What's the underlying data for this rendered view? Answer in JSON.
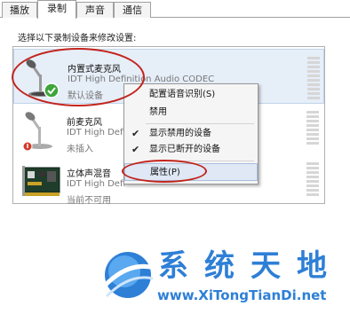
{
  "tabs": [
    {
      "label": "播放"
    },
    {
      "label": "录制"
    },
    {
      "label": "声音"
    },
    {
      "label": "通信"
    }
  ],
  "instruction": "选择以下录制设备来修改设置:",
  "devices": [
    {
      "name": "内置式麦克风",
      "description": "IDT High Definition Audio CODEC",
      "status": "默认设备",
      "icon": "microphone-default-icon"
    },
    {
      "name": "前麦克风",
      "description": "IDT High Defi",
      "status": "未插入",
      "icon": "microphone-unplugged-icon"
    },
    {
      "name": "立体声混音",
      "description": "IDT High Defi",
      "status": "当前不可用",
      "icon": "sound-card-icon"
    }
  ],
  "context_menu": {
    "items": [
      {
        "label": "配置语音识别(S)",
        "checked": false
      },
      {
        "label": "禁用",
        "checked": false
      },
      {
        "label": "显示禁用的设备",
        "checked": true
      },
      {
        "label": "显示已断开的设备",
        "checked": true
      },
      {
        "label": "属性(P)",
        "checked": false,
        "highlighted": true
      }
    ]
  },
  "watermark": {
    "title": "系统天地",
    "url": "www.XiTongTianDi.net"
  },
  "colors": {
    "annotation": "#c2241d",
    "watermark": "#2e7fd6",
    "selection": "#e6eef8"
  }
}
